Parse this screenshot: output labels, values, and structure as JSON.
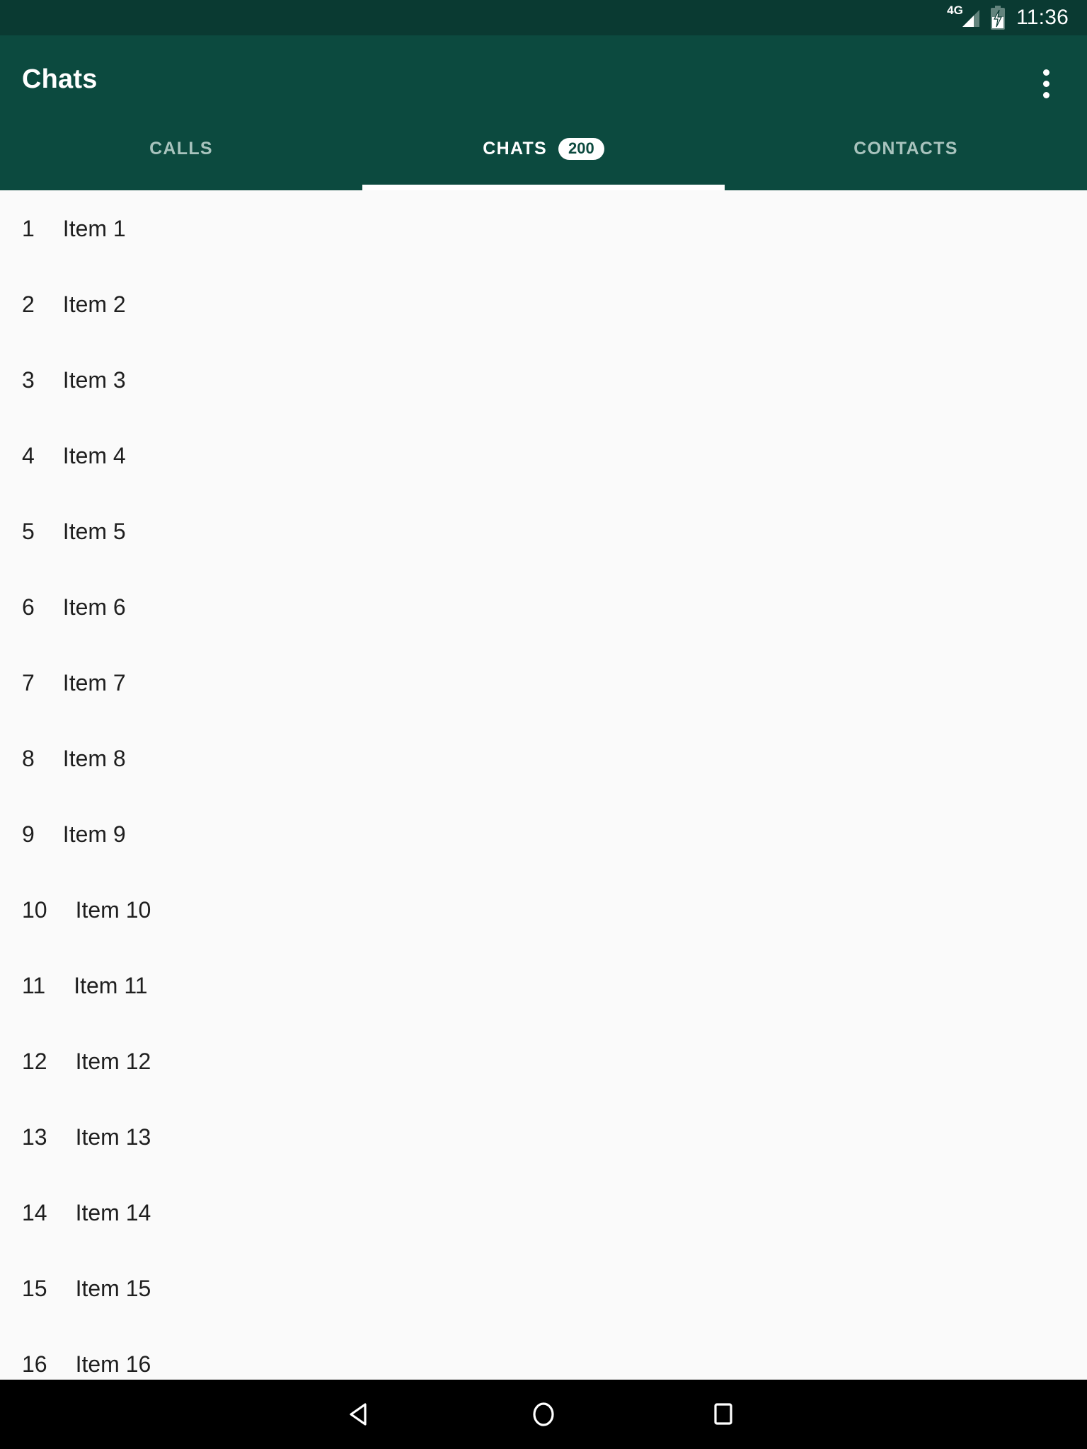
{
  "status_bar": {
    "network_label": "4G",
    "signal_icon": "signal-bars-icon",
    "battery_icon": "battery-charging-icon",
    "time": "11:36",
    "background_color": "#0a3a32"
  },
  "app_bar": {
    "title": "Chats",
    "overflow_icon": "more-vert-icon",
    "background_color": "#0c4a3f",
    "title_color": "#ffffff"
  },
  "tabs": {
    "active_index": 1,
    "indicator_color": "#ffffff",
    "inactive_color": "#a8c3bd",
    "items": [
      {
        "label": "CALLS",
        "badge": null
      },
      {
        "label": "CHATS",
        "badge": "200"
      },
      {
        "label": "CONTACTS",
        "badge": null
      }
    ]
  },
  "list": {
    "background_color": "#fafafa",
    "text_color": "#1f1f1f",
    "rows": [
      {
        "index": "1",
        "label": "Item 1"
      },
      {
        "index": "2",
        "label": "Item 2"
      },
      {
        "index": "3",
        "label": "Item 3"
      },
      {
        "index": "4",
        "label": "Item 4"
      },
      {
        "index": "5",
        "label": "Item 5"
      },
      {
        "index": "6",
        "label": "Item 6"
      },
      {
        "index": "7",
        "label": "Item 7"
      },
      {
        "index": "8",
        "label": "Item 8"
      },
      {
        "index": "9",
        "label": "Item 9"
      },
      {
        "index": "10",
        "label": "Item 10"
      },
      {
        "index": "11",
        "label": "Item 11"
      },
      {
        "index": "12",
        "label": "Item 12"
      },
      {
        "index": "13",
        "label": "Item 13"
      },
      {
        "index": "14",
        "label": "Item 14"
      },
      {
        "index": "15",
        "label": "Item 15"
      },
      {
        "index": "16",
        "label": "Item 16"
      }
    ]
  },
  "nav_bar": {
    "background_color": "#000000",
    "buttons": [
      {
        "name": "back",
        "icon": "triangle-back-icon"
      },
      {
        "name": "home",
        "icon": "circle-home-icon"
      },
      {
        "name": "recents",
        "icon": "square-recents-icon"
      }
    ]
  }
}
